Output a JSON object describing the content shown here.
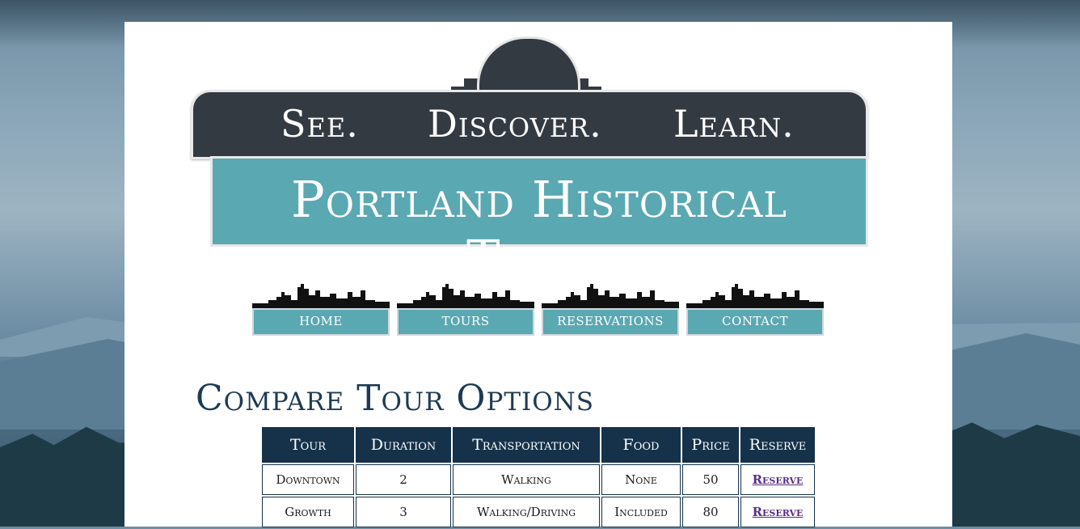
{
  "banner": {
    "motto": [
      "See.",
      "Discover.",
      "Learn."
    ],
    "brand": "Portland Historical Tours"
  },
  "nav": {
    "items": [
      {
        "label": "HOME"
      },
      {
        "label": "TOURS"
      },
      {
        "label": "RESERVATIONS"
      },
      {
        "label": "CONTACT"
      }
    ]
  },
  "main": {
    "heading": "Compare Tour Options",
    "table": {
      "headers": [
        "Tour",
        "Duration",
        "Transportation",
        "Food",
        "Price",
        "Reserve"
      ],
      "rows": [
        {
          "tour": "Downtown",
          "duration": "2",
          "transportation": "Walking",
          "food": "None",
          "price": "50",
          "reserve": "Reserve"
        },
        {
          "tour": "Growth",
          "duration": "3",
          "transportation": "Walking/Driving",
          "food": "Included",
          "price": "80",
          "reserve": "Reserve"
        }
      ]
    }
  },
  "colors": {
    "sign_dark": "#343a42",
    "sign_teal": "#5aa8b2",
    "heading_navy": "#1d3a52",
    "table_header": "#15324a",
    "link_purple": "#5a2c86"
  }
}
